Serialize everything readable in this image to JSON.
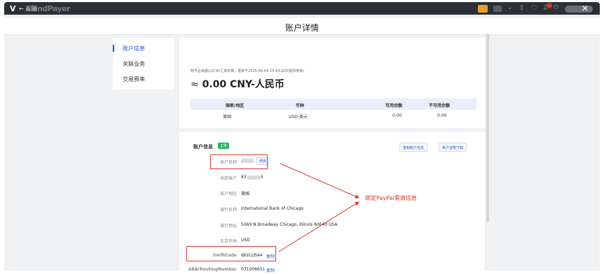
{
  "topbar": {
    "logo_prefix": "V",
    "logo_faded": "endPayer",
    "back_label": "← 返回"
  },
  "header": {
    "title": "账户详情"
  },
  "sidebar": {
    "items": [
      {
        "label": "账户信息",
        "active": true
      },
      {
        "label": "关联业务",
        "active": false
      },
      {
        "label": "交易费率",
        "active": false
      }
    ]
  },
  "balance": {
    "caption": "账号总余额(以CNY汇率折算，更新于2025-06-04 15:44:02仅提供参考)",
    "approx": "≈",
    "amount": "0.00 CNY-人民币",
    "table": {
      "headers": [
        "国家/地区",
        "币种",
        "可用余额",
        "不可用余额"
      ],
      "rows": [
        [
          "美国",
          "USD-美元",
          "0.00",
          "0.00"
        ]
      ]
    }
  },
  "account_info": {
    "title": "账户信息",
    "status": "正常",
    "copy_button": "复制账户信息",
    "download_button": "账户证明下载",
    "fields": [
      {
        "label": "账户名称",
        "value": "",
        "masked": true,
        "action": "修改"
      },
      {
        "label": "收款账户",
        "value_prefix": "83",
        "value_suffix": "4",
        "masked": true
      },
      {
        "label": "账户地区",
        "value": "美国"
      },
      {
        "label": "银行名称",
        "value": "International Bank of Chicago"
      },
      {
        "label": "银行地址",
        "value": "5069 N.Broadway Chicago, Illinois 60640 USA"
      },
      {
        "label": "支持币种",
        "value": "USD"
      },
      {
        "label": "SwiftCode",
        "value": "IBOCUS44",
        "action": "复制"
      },
      {
        "label": "ABA/RoutingNumber",
        "value": "071006651",
        "action": "复制"
      }
    ]
  },
  "annotation": {
    "text": "绑定PayPal需填信息",
    "color": "#e0382f"
  }
}
